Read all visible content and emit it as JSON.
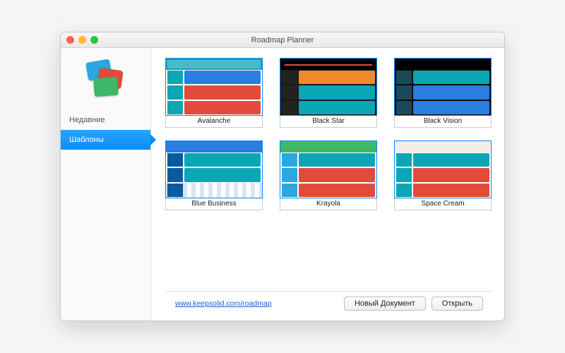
{
  "window": {
    "title": "Roadmap Planner"
  },
  "sidebar": {
    "items": [
      {
        "label": "Недавние"
      },
      {
        "label": "Шаблоны"
      }
    ],
    "active_index": 1
  },
  "templates": [
    {
      "name": "Avalanche",
      "theme": "light"
    },
    {
      "name": "Black Star",
      "theme": "dark1"
    },
    {
      "name": "Black Vision",
      "theme": "dark2"
    },
    {
      "name": "Blue Business",
      "theme": "light"
    },
    {
      "name": "Krayola",
      "theme": "light"
    },
    {
      "name": "Space Cream",
      "theme": "light"
    }
  ],
  "footer": {
    "link_text": "www.keepsolid.com/roadmap",
    "new_doc_label": "Новый Документ",
    "open_label": "Открыть"
  },
  "colors": {
    "accent": "#0a8cff",
    "teal": "#0aa6b5",
    "red": "#e24b3b",
    "orange": "#f08a2a",
    "blue": "#2a7de1",
    "green": "#3fb768"
  }
}
